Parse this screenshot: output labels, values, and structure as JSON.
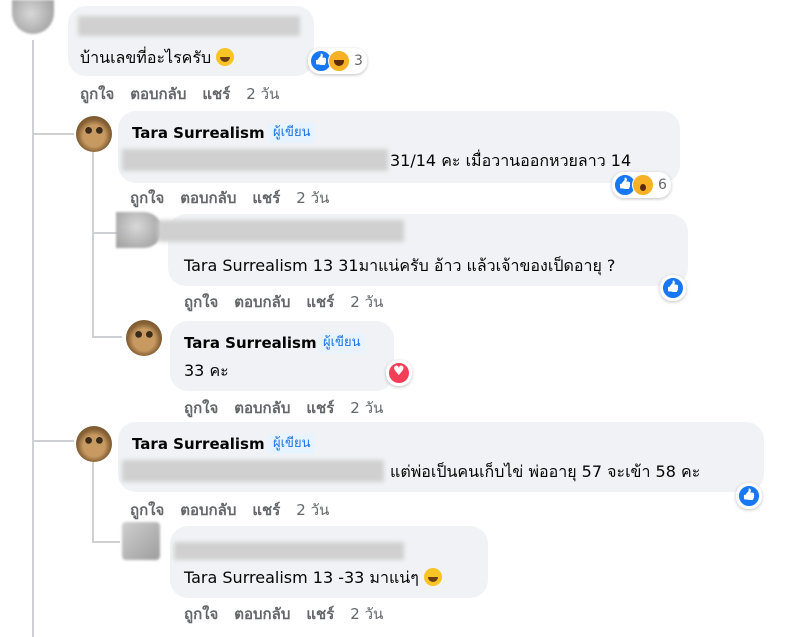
{
  "actions": {
    "like": "ถูกใจ",
    "reply": "ตอบกลับ",
    "share": "แชร์",
    "time": "2 วัน"
  },
  "author_badge": "ผู้เขียน",
  "comments": [
    {
      "text": "บ้านเลขที่อะไรครับ",
      "emoji": "grinning-face",
      "reaction_count": "3"
    },
    {
      "author": "Tara Surrealism",
      "text": "31/14 คะ เมื่อวานออกหวยลาว 14",
      "reaction_count": "6"
    },
    {
      "text": "Tara Surrealism 13 31มาแน่ครับ อ้าว แล้วเจ้าของเป็ดอายุ ?"
    },
    {
      "author": "Tara Surrealism",
      "text": "33 คะ"
    },
    {
      "author": "Tara Surrealism",
      "text": "แต่พ่อเป็นคนเก็บไข่ พ่ออายุ 57 จะเข้า 58 คะ"
    },
    {
      "text": "Tara Surrealism 13 -33 มาแน่ๆ",
      "emoji": "smiling-face"
    }
  ],
  "colors": {
    "bubble": "#f0f2f5",
    "badge_text": "#1b74e4",
    "badge_bg": "#e7f3ff",
    "like": "#1877f2",
    "love": "#f33e58",
    "meta": "#65676b"
  }
}
